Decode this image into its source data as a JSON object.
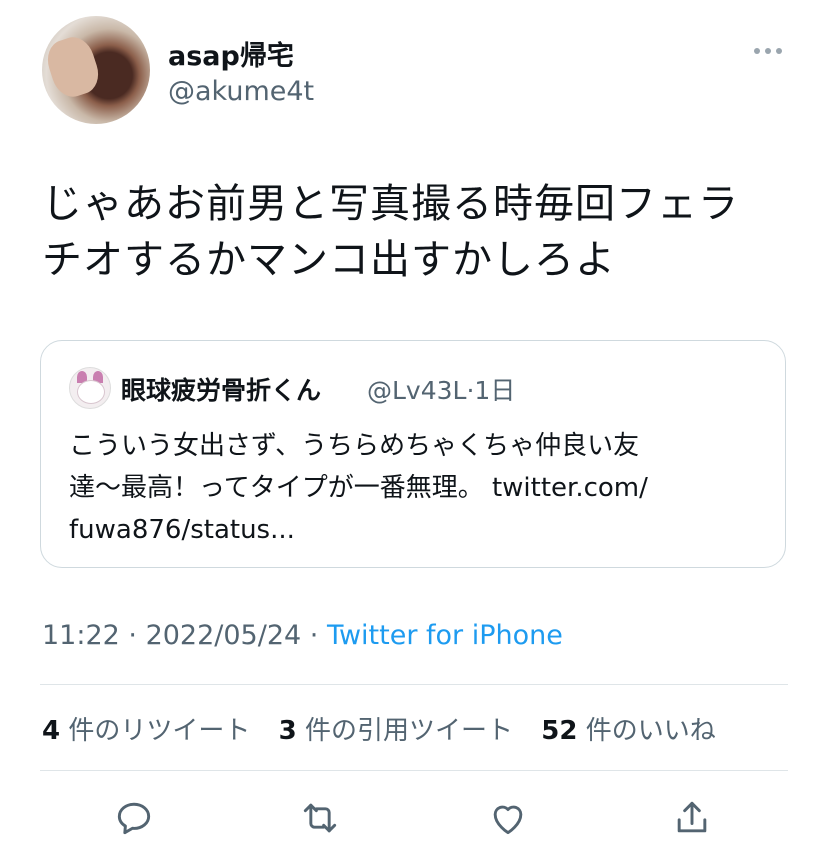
{
  "tweet": {
    "display_name": "asap帰宅",
    "handle": "@akume4t",
    "text_line1": "じゃあお前男と写真撮る時毎回フェラ",
    "text_line2": "チオするかマンコ出すかしろよ"
  },
  "quote": {
    "display_name": "眼球疲労骨折くん",
    "handle": "@Lv43L",
    "separator": "·",
    "time": "1日",
    "text_line1": "こういう女出さず、うちらめちゃくちゃ仲良い友",
    "text_line2": "達〜最高！ってタイプが一番無理。 twitter.com/",
    "text_line3": "fuwa876/status..."
  },
  "meta": {
    "time": "11:22",
    "sep1": " · ",
    "date": "2022/05/24",
    "sep2": " · ",
    "source": "Twitter for iPhone"
  },
  "stats": {
    "retweets_count": "4",
    "retweets_label": "件のリツイート",
    "quotes_count": "3",
    "quotes_label": "件の引用ツイート",
    "likes_count": "52",
    "likes_label": "件のいいね"
  },
  "icons": {
    "more": "more-icon",
    "reply": "reply-icon",
    "retweet": "retweet-icon",
    "like": "heart-icon",
    "share": "share-icon"
  },
  "colors": {
    "link": "#1d9bf0",
    "secondary_text": "#536471",
    "border": "#cfd9de"
  }
}
